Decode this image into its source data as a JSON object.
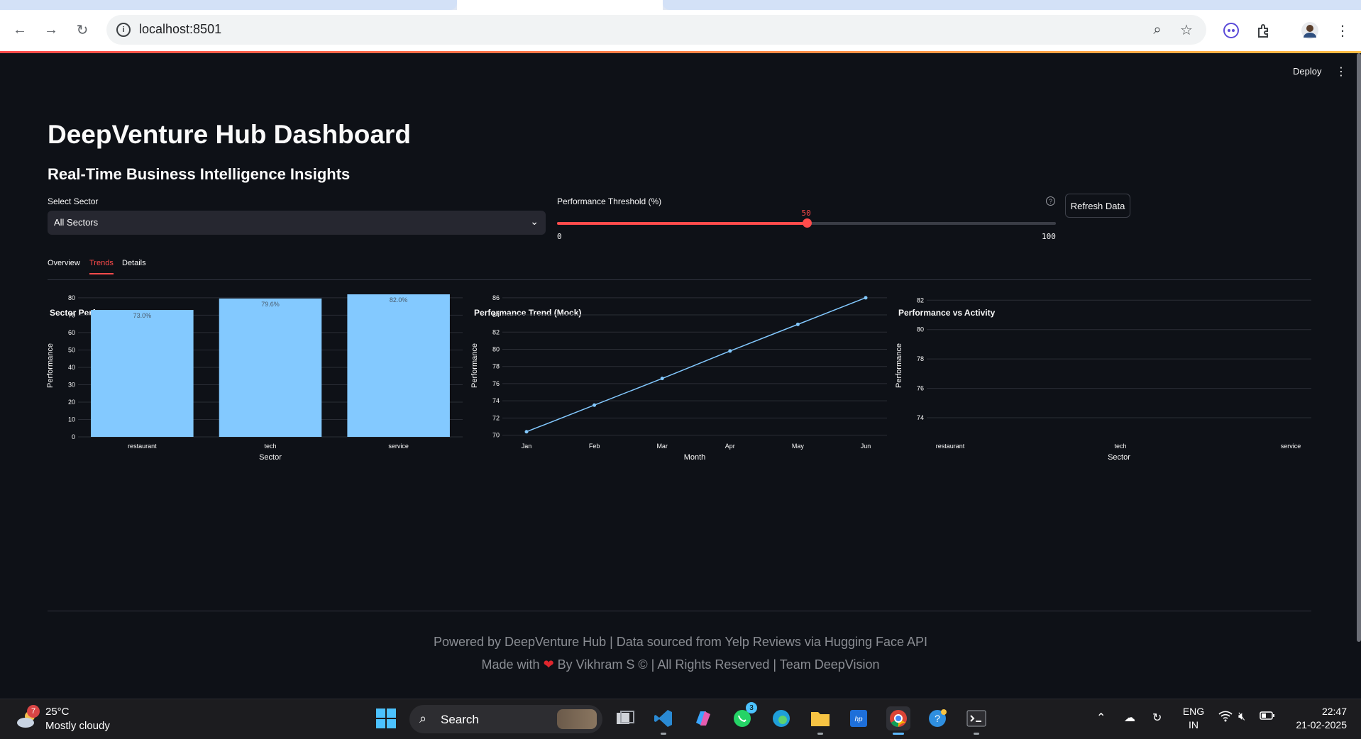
{
  "browser": {
    "url": "localhost:8501"
  },
  "app": {
    "deploy_label": "Deploy",
    "title": "DeepVenture Hub Dashboard",
    "subtitle": "Real-Time Business Intelligence Insights",
    "sector_select": {
      "label": "Select Sector",
      "value": "All Sectors"
    },
    "threshold": {
      "label": "Performance Threshold (%)",
      "value": 50,
      "min": 0,
      "max": 100
    },
    "refresh_label": "Refresh Data",
    "tabs": [
      {
        "label": "Overview",
        "active": false
      },
      {
        "label": "Trends",
        "active": true
      },
      {
        "label": "Details",
        "active": false
      }
    ],
    "footer_line1": "Powered by DeepVenture Hub | Data sourced from Yelp Reviews via Hugging Face API",
    "footer_made_with": "Made with",
    "footer_by": "By Vikhram S © | All Rights Reserved | Team DeepVision",
    "accent_color": "#ff4b4b",
    "bar_color": "#83c9ff"
  },
  "chart_data": [
    {
      "type": "bar",
      "title": "Sector Performance",
      "categories": [
        "restaurant",
        "tech",
        "service"
      ],
      "values": [
        73.0,
        79.6,
        82.0
      ],
      "data_labels": [
        "73.0%",
        "79.6%",
        "82.0%"
      ],
      "xlabel": "Sector",
      "ylabel": "Performance",
      "ylim": [
        0,
        82
      ],
      "yticks": [
        0,
        10,
        20,
        30,
        40,
        50,
        60,
        70,
        80
      ]
    },
    {
      "type": "line",
      "title": "Performance Trend (Mock)",
      "x": [
        "Jan",
        "Feb",
        "Mar",
        "Apr",
        "May",
        "Jun"
      ],
      "values": [
        70.4,
        73.5,
        76.6,
        79.8,
        82.9,
        86.0
      ],
      "xlabel": "Month",
      "ylabel": "Performance",
      "ylim": [
        69.8,
        86.4
      ],
      "yticks": [
        70,
        72,
        74,
        76,
        78,
        80,
        82,
        84,
        86
      ]
    },
    {
      "type": "scatter",
      "title": "Performance vs Activity",
      "categories": [
        "restaurant",
        "tech",
        "service"
      ],
      "values": [],
      "xlabel": "Sector",
      "ylabel": "Performance",
      "ylim": [
        72.7,
        82.4
      ],
      "yticks": [
        74,
        76,
        78,
        80,
        82
      ]
    }
  ],
  "taskbar": {
    "weather_badge": "7",
    "temperature": "25°C",
    "condition": "Mostly cloudy",
    "search_label": "Search",
    "whatsapp_badge": "3",
    "lang_top": "ENG",
    "lang_bottom": "IN",
    "time": "22:47",
    "date": "21-02-2025"
  }
}
